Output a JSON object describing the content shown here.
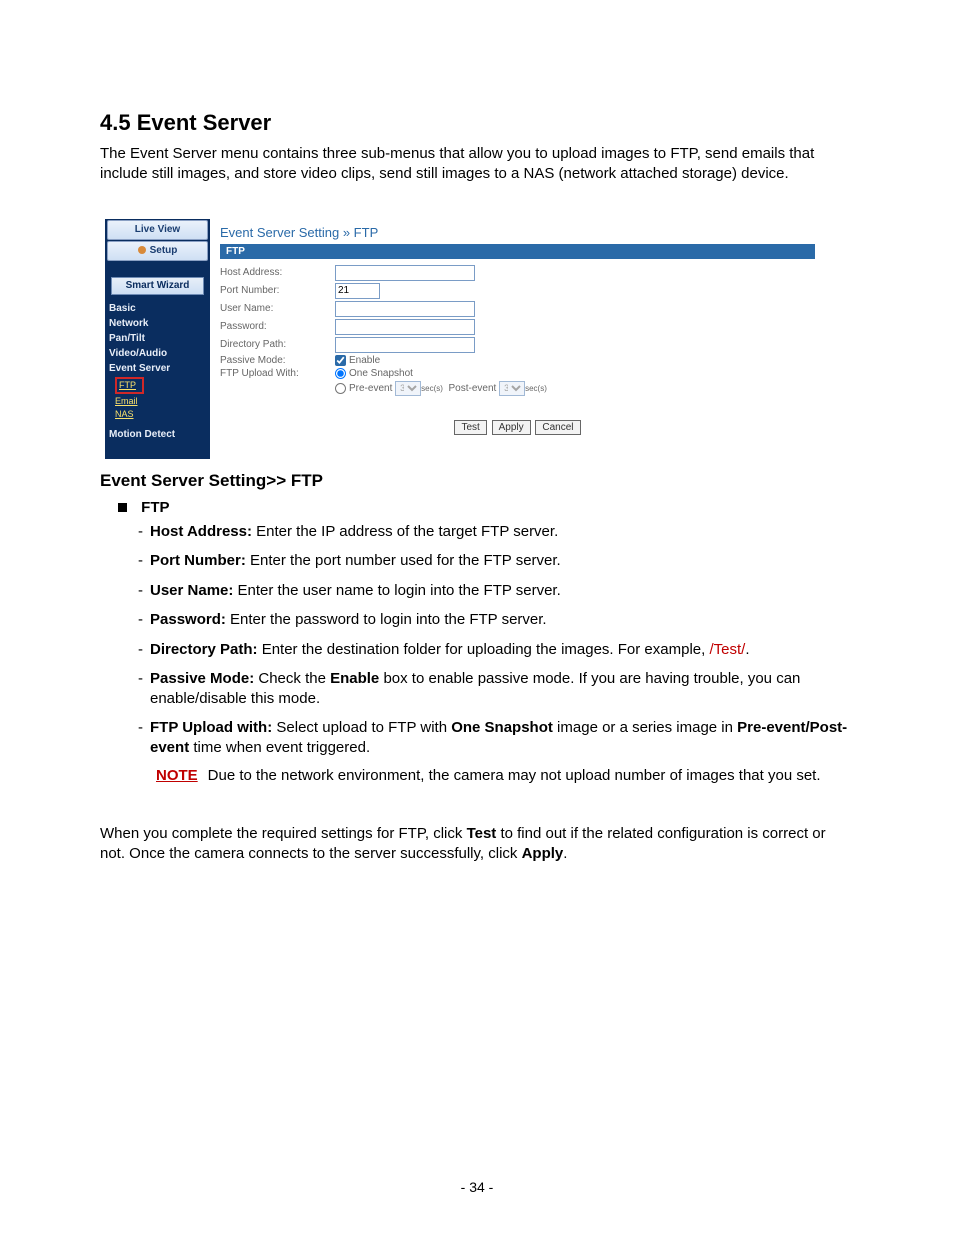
{
  "heading": "4.5  Event Server",
  "intro": "The Event Server menu contains three sub-menus that allow you to upload images to FTP, send emails that include still images, and store video clips, send still images to a NAS (network attached storage) device.",
  "embed": {
    "tabs": {
      "live": "Live View",
      "setup": "Setup"
    },
    "smart_wizard": "Smart Wizard",
    "sidebar": {
      "basic": "Basic",
      "network": "Network",
      "pantilt": "Pan/Tilt",
      "va": "Video/Audio",
      "eventserver": "Event Server",
      "ftp": "FTP",
      "email": "Email",
      "nas": "NAS",
      "motion": "Motion Detect"
    },
    "crumb": "Event Server Setting » FTP",
    "section": "FTP",
    "labels": {
      "host": "Host Address:",
      "port": "Port Number:",
      "user": "User Name:",
      "pass": "Password:",
      "dir": "Directory Path:",
      "passive": "Passive Mode:",
      "upload": "FTP Upload With:"
    },
    "values": {
      "port": "21"
    },
    "enable": "Enable",
    "one_snapshot": "One Snapshot",
    "preevent": "Pre-event",
    "postevent": "Post-event",
    "secs": "sec(s)",
    "sel_val": "3",
    "buttons": {
      "test": "Test",
      "apply": "Apply",
      "cancel": "Cancel"
    }
  },
  "subhead": "Event Server Setting>> FTP",
  "bullet_label": "FTP",
  "items": {
    "host": {
      "label": "Host Address:",
      "text": " Enter the IP address of the target FTP server."
    },
    "port": {
      "label": "Port Number:",
      "text": " Enter the port number used for the FTP server."
    },
    "user": {
      "label": "User Name:",
      "text": " Enter the user name to login into the FTP server."
    },
    "pass": {
      "label": "Password:",
      "text": " Enter the password to login into the FTP server."
    },
    "dir": {
      "label": "Directory Path:",
      "text": " Enter the destination folder for uploading the images. For example, ",
      "example": "/Test/",
      "tail": "."
    },
    "passive": {
      "label": "Passive Mode:",
      "text_a": " Check the ",
      "enable": "Enable",
      "text_b": " box to enable passive mode.  If you are having trouble, you can enable/disable this mode."
    },
    "upload": {
      "label": "FTP Upload with:",
      "text_a": " Select upload to FTP with ",
      "one": "One Snapshot",
      "text_b": " image or a series image in ",
      "pre": "Pre-event/Post-event",
      "text_c": " time when event triggered."
    }
  },
  "note": {
    "label": "NOTE",
    "text": "Due to the network environment, the camera may not upload number of images that you set."
  },
  "after": {
    "a": "When you complete the required settings for FTP, click ",
    "test": "Test",
    "b": " to find out if the related configuration is correct or not. Once the camera connects to the server successfully, click ",
    "apply": "Apply",
    "c": "."
  },
  "page_num": "- 34 -"
}
